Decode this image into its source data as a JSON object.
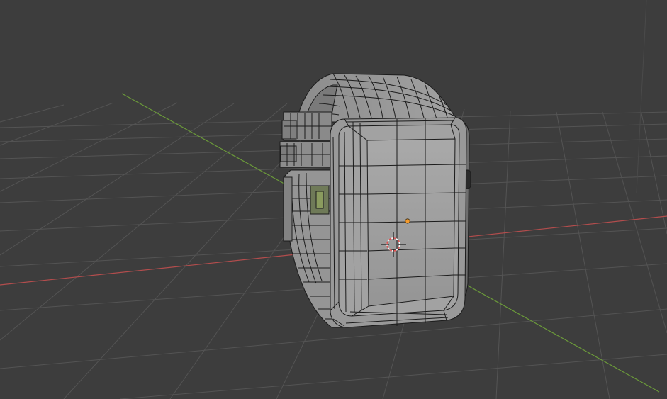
{
  "viewport": {
    "name": "3D Viewport",
    "background_color": "#3d3d3d",
    "grid_color": "#545454",
    "x_axis_color": "#b34d4d",
    "y_axis_color": "#6b9a3a",
    "shading": "solid",
    "overlay": "wireframe"
  },
  "scene": {
    "object": {
      "type": "mesh",
      "depicts": "smartwatch",
      "mode": "edit",
      "face_color": "#9d9d9d",
      "edge_color": "#1b1b1b"
    },
    "origin_color": "#f29a2e",
    "cursor_color": "#e05050"
  }
}
